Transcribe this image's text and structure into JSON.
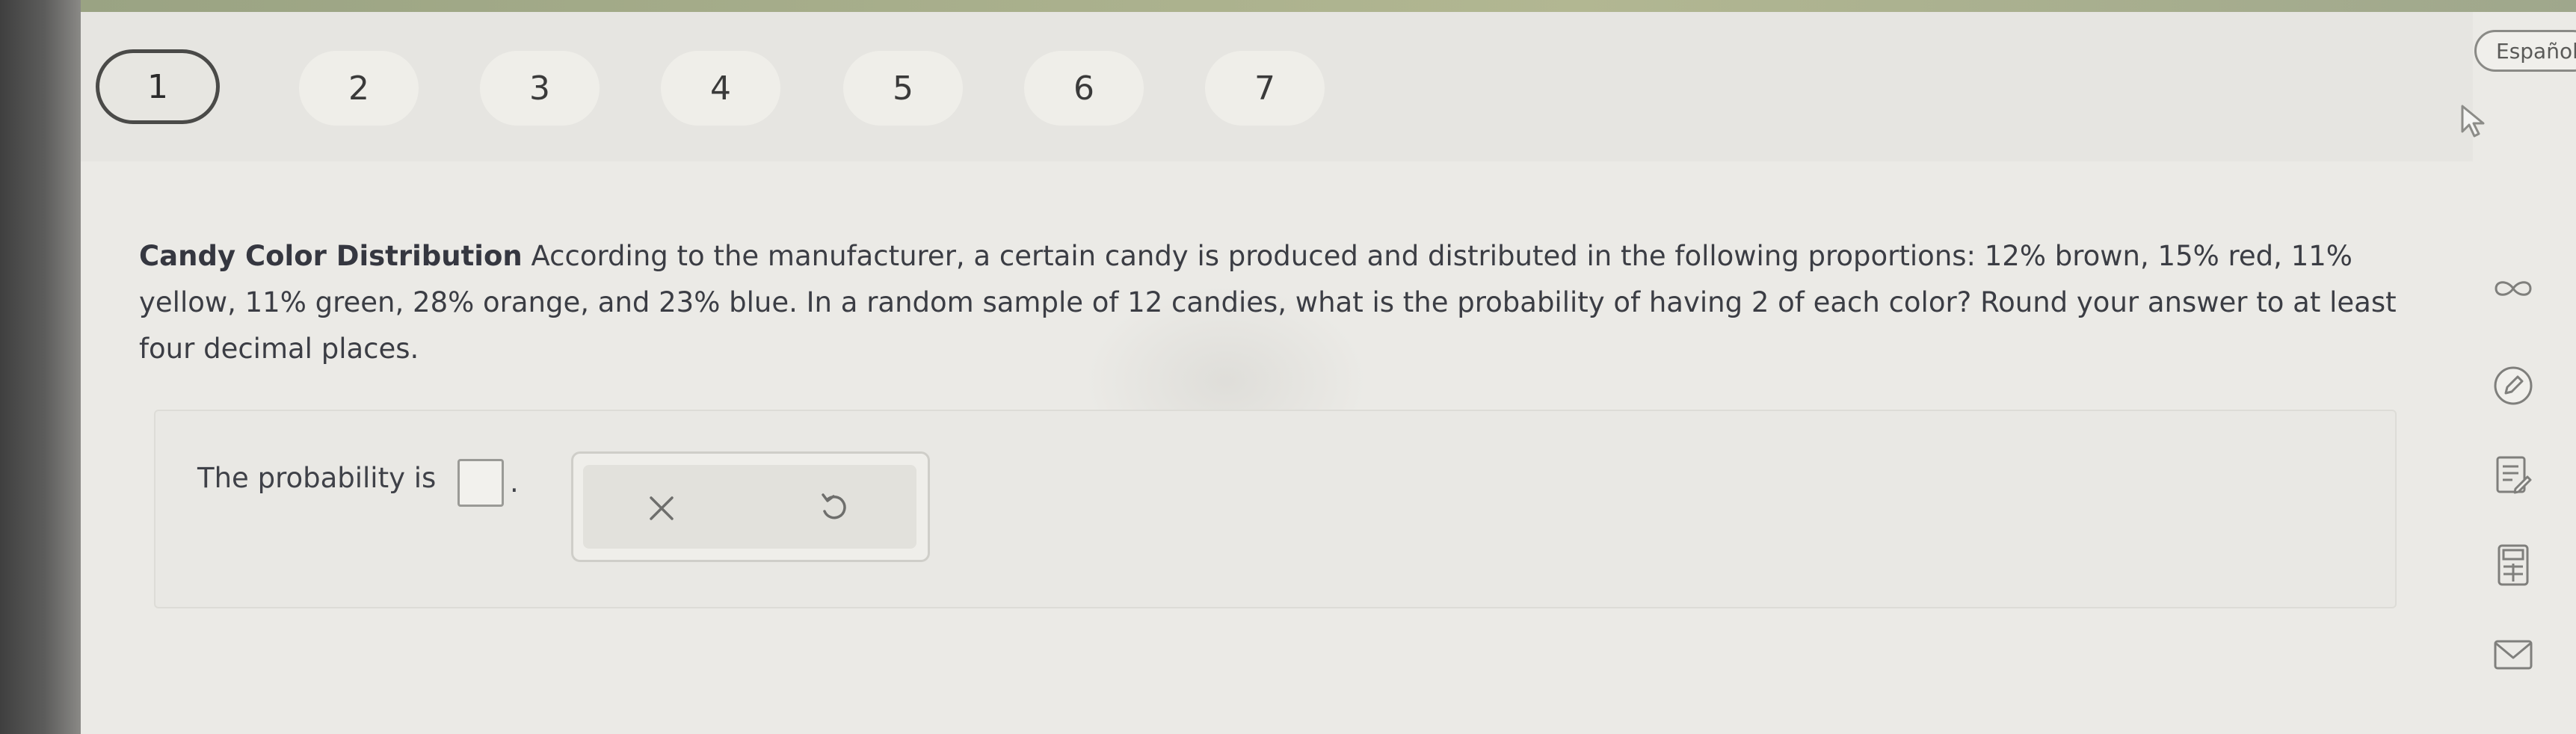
{
  "language": {
    "label": "Español"
  },
  "steps": [
    {
      "label": "1",
      "active": true
    },
    {
      "label": "2",
      "active": false
    },
    {
      "label": "3",
      "active": false
    },
    {
      "label": "4",
      "active": false
    },
    {
      "label": "5",
      "active": false
    },
    {
      "label": "6",
      "active": false
    },
    {
      "label": "7",
      "active": false
    }
  ],
  "question": {
    "title": "Candy Color Distribution",
    "text": "According to the manufacturer, a certain candy is produced and distributed in the following proportions: 12% brown, 15% red, 11% yellow, 11% green, 28% orange, and 23% blue. In a random sample of 12 candies, what is the probability of having 2 of each color? Round your answer to at least four decimal places."
  },
  "answer": {
    "label": "The probability is",
    "value": "",
    "suffix": "."
  },
  "tools": {
    "clear_icon": "close-icon",
    "undo_icon": "undo-icon"
  },
  "sidebar_icons": [
    "infinity-icon",
    "pencil-circle-icon",
    "notes-icon",
    "calculator-icon",
    "mail-icon"
  ],
  "colors": {
    "background": "#ebeae6",
    "text": "#3b3d44",
    "active_border": "#4a4a48"
  }
}
